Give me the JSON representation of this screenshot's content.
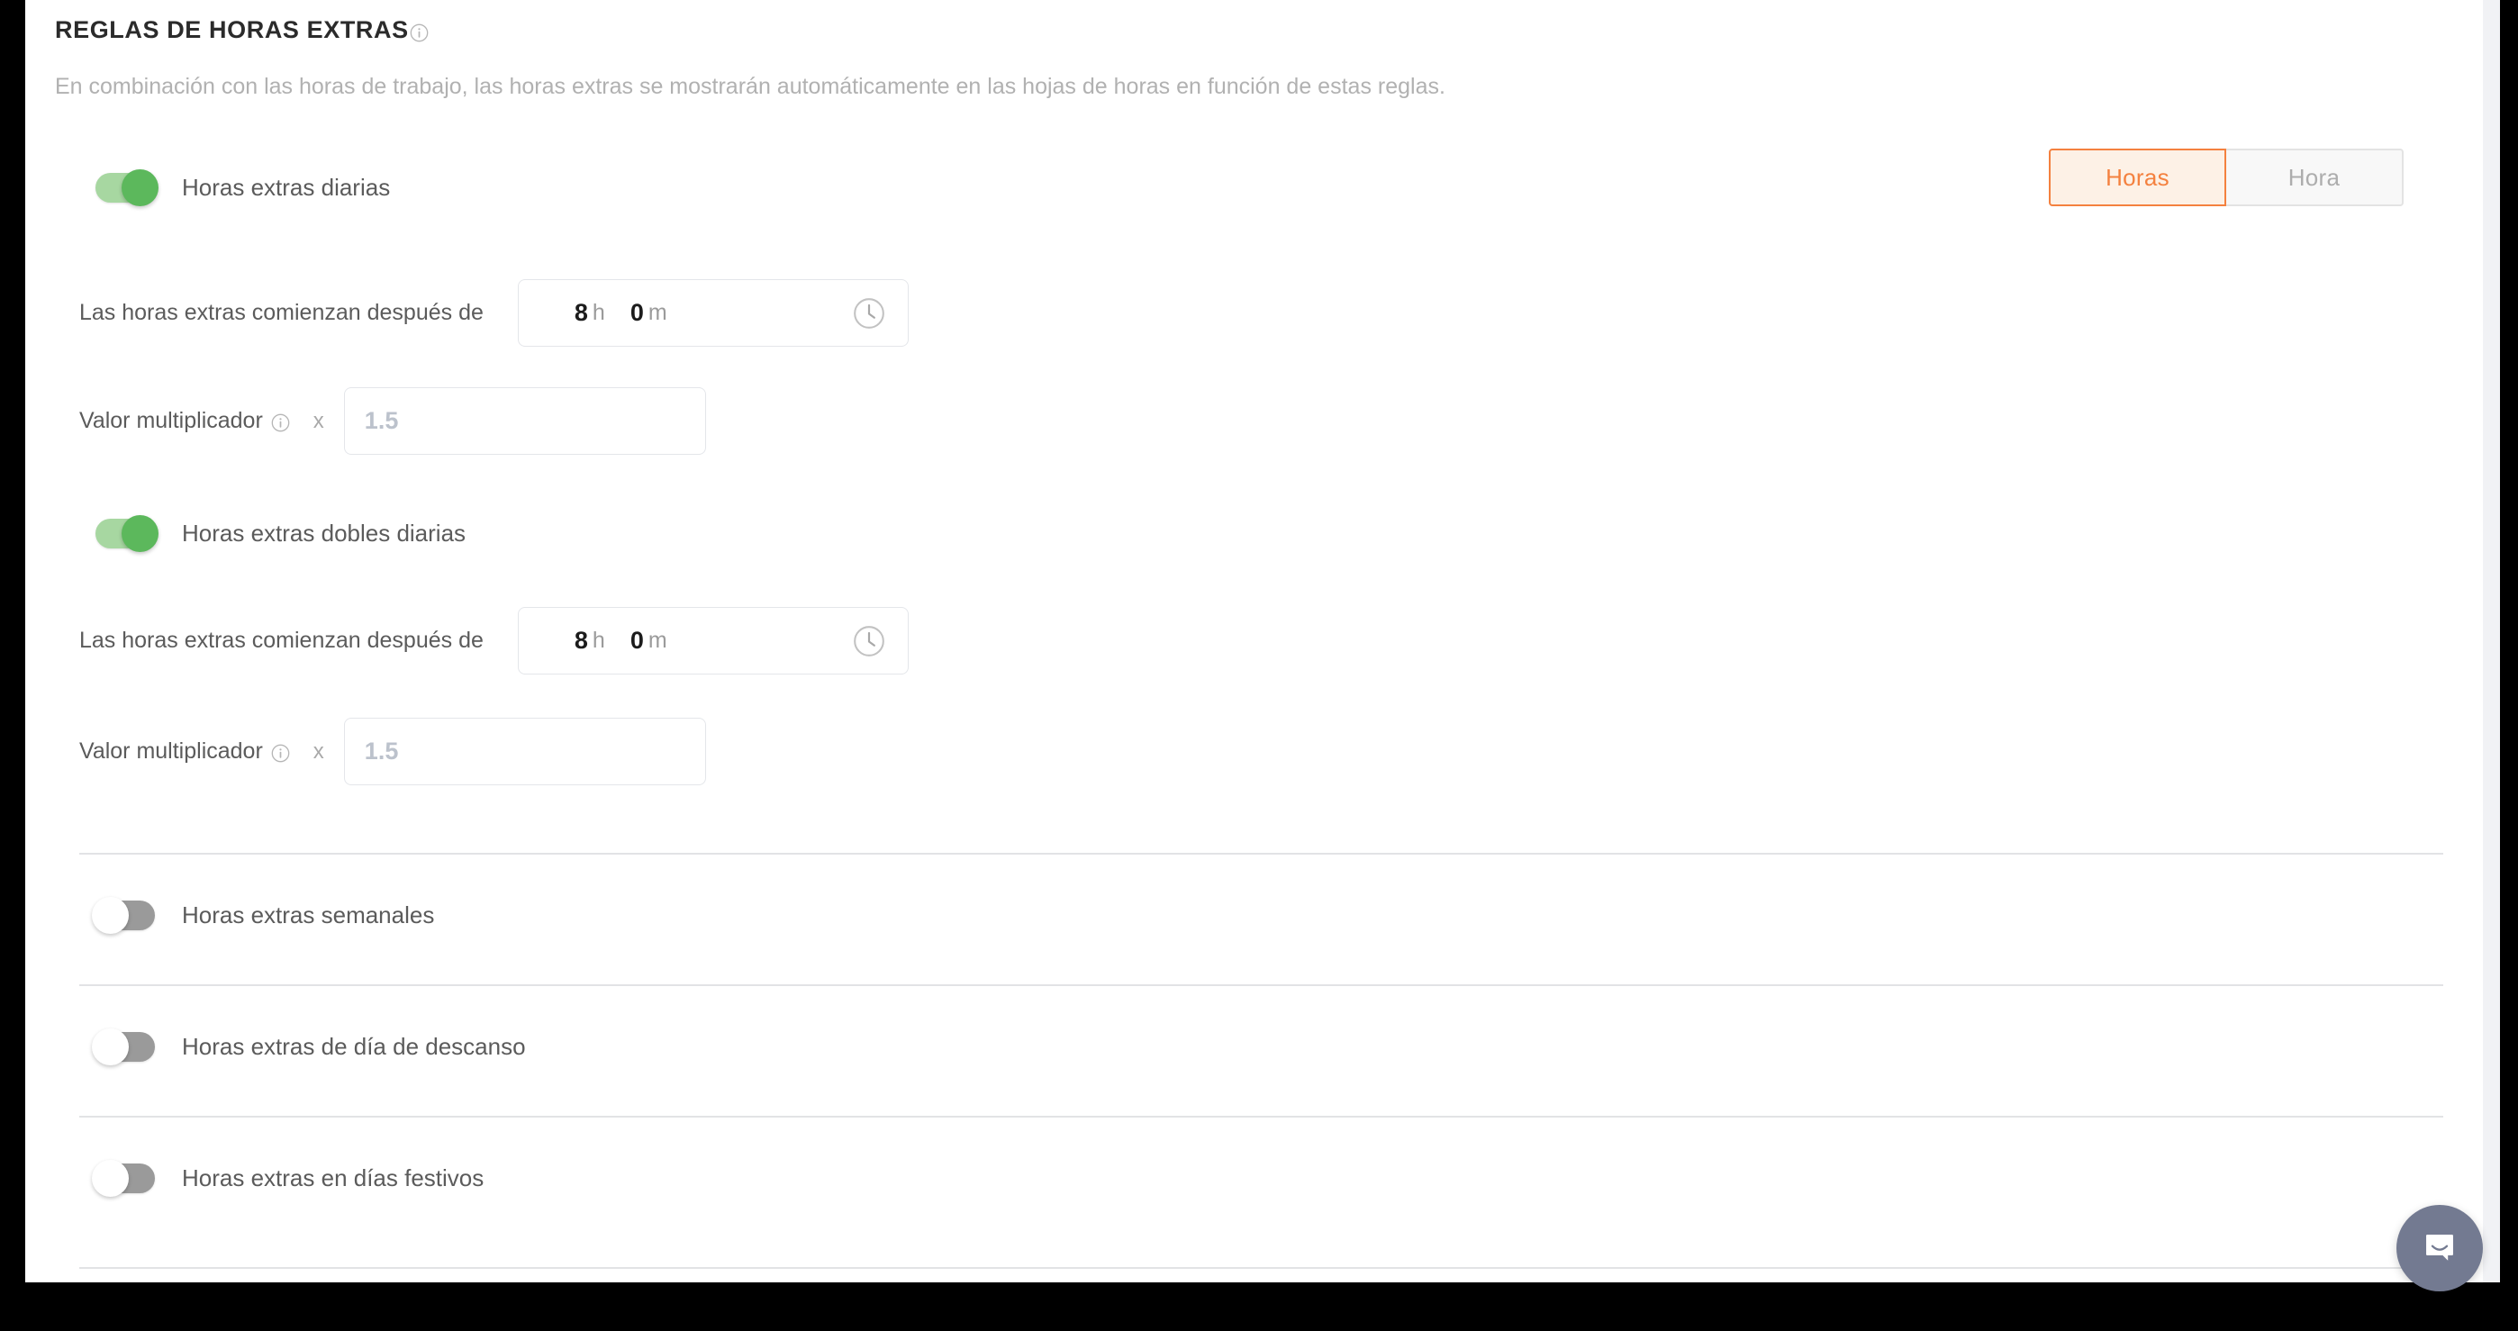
{
  "section": {
    "title": "REGLAS DE HORAS EXTRAS",
    "title_info_icon": "info-icon",
    "description": "En combinación con las horas de trabajo, las horas extras se mostrarán automáticamente en las hojas de horas en función de estas reglas."
  },
  "unit_toggle": {
    "active_label": "Horas",
    "inactive_label": "Hora",
    "active_color": "#f4813f",
    "active_bg": "#fdf1e6",
    "inactive_color": "#adadad"
  },
  "colors": {
    "switch_on_track": "#a7d7a1",
    "switch_on_knob": "#5cb85c",
    "switch_off_track": "#9a9a9a",
    "switch_off_knob": "#ffffff",
    "accent": "#f4813f",
    "divider": "#e2e3e5",
    "intercom": "#737a91"
  },
  "rules": {
    "daily": {
      "toggle_label": "Horas extras diarias",
      "enabled": true,
      "start_after_label": "Las horas extras comienzan después de",
      "hours_value": "8",
      "hours_unit": "h",
      "minutes_value": "0",
      "minutes_unit": "m",
      "clock_icon": "clock-icon",
      "multiplier_label": "Valor multiplicador",
      "multiplier_info_icon": "info-icon",
      "multiplier_operator": "x",
      "multiplier_placeholder": "1.5",
      "multiplier_value": ""
    },
    "daily_double": {
      "toggle_label": "Horas extras dobles diarias",
      "enabled": true,
      "start_after_label": "Las horas extras comienzan después de",
      "hours_value": "8",
      "hours_unit": "h",
      "minutes_value": "0",
      "minutes_unit": "m",
      "clock_icon": "clock-icon",
      "multiplier_label": "Valor multiplicador",
      "multiplier_info_icon": "info-icon",
      "multiplier_operator": "x",
      "multiplier_placeholder": "1.5",
      "multiplier_value": ""
    },
    "weekly": {
      "toggle_label": "Horas extras semanales",
      "enabled": false
    },
    "rest_day": {
      "toggle_label": "Horas extras de día de descanso",
      "enabled": false
    },
    "holiday": {
      "toggle_label": "Horas extras en días festivos",
      "enabled": false
    }
  },
  "support": {
    "launcher_icon": "chat-bubble-icon"
  }
}
